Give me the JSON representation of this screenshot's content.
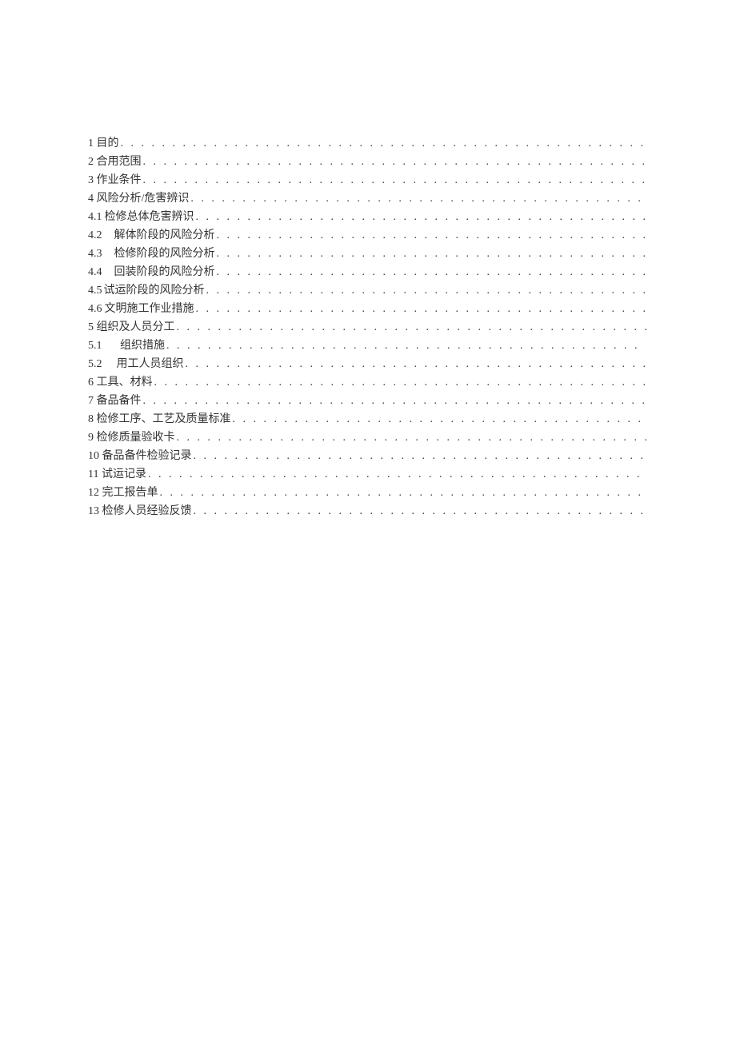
{
  "toc": [
    {
      "label": "1 目的",
      "dots": ". . . . . . . . . . . . . . . . . . . . . . . . . . . . . . . . . . . . . . . . . . . . . . . . . . . . . . . . ."
    },
    {
      "label": "2 合用范围",
      "dots": ". . . . . . . . . . . . . . . . . . . . . . . . . . . . . . . . . . . . . . . . . . . . . . . . . . . ."
    },
    {
      "label": "3 作业条件",
      "dots": ". . . . . . . . . . . . . . . . . . . . . . . . . . . . . . . . . . . . . . . . . . . . . . . . . . . . ."
    },
    {
      "label": "4 风险分析/危害辨识",
      "dots": " . . . . . . . . . . . . . . . . . . . . . . . . . . . . . . . . . . . . . . . . . . . . . . ."
    },
    {
      "num": "4.1",
      "label": "检修总体危害辨识",
      "dots": ". . . . . . . . . . . . . . . . . . . . . . . . . . . . . . . . . . . . . . . . . . . ."
    },
    {
      "num": "4.2",
      "label": "解体阶段的风险分析",
      "dots": " . . . . . . . . . . . . . . . . . . . . . . . . . . . . . . . . . . . . . . . . . ."
    },
    {
      "num": "4.3",
      "label": "检修阶段的风险分析",
      "dots": " . . . . . . . . . . . . . . . . . . . . . . . . . . . . . . . . . . . . . . . . . ."
    },
    {
      "num": "4.4",
      "label": "回装阶段的风险分析",
      "dots": " . . . . . . . . . . . . . . . . . . . . . . . . . . . . . . . . . . . . . . . . . ."
    },
    {
      "num": "4.5",
      "label": "试运阶段的风险分析",
      "dots": " . . . . . . . . . . . . . . . . . . . . . . . . . . . . . . . . . . . . . . . . . . ."
    },
    {
      "num": "4.6",
      "label": "文明施工作业措施",
      "dots": " . . . . . . . . . . . . . . . . . . . . . . . . . . . . . . . . . . . . . . . . . . . ."
    },
    {
      "label": "5 组织及人员分工",
      "dots": ". . . . . . . . . . . . . . . . . . . . . . . . . . . . . . . . . . . . . . . . . . . . . . . . ."
    },
    {
      "num": "5.1",
      "label": "组织措施",
      "dots": " . . . . . . . . . . . . . . . . . . . . . . . . . . . . . . . . . . . . . . . . . . . . . ."
    },
    {
      "num": "5.2",
      "label": "用工人员组织",
      "dots": " . . . . . . . . . . . . . . . . . . . . . . . . . . . . . . . . . . . . . . . . . . . . ."
    },
    {
      "label": "6 工具、材料",
      "dots": ". . . . . . . . . . . . . . . . . . . . . . . . . . . . . . . . . . . . . . . . . . . . . . . . ."
    },
    {
      "label": "7 备品备件",
      "dots": ". . . . . . . . . . . . . . . . . . . . . . . . . . . . . . . . . . . . . . . . . . . . . . . . . . . ."
    },
    {
      "label": "8 检修工序、工艺及质量标准",
      "dots": " . . . . . . . . . . . . . . . . . . . . . . . . . . . . . . . . . . . . . . . . . . . . ."
    },
    {
      "label": "9 检修质量验收卡",
      "dots": ". . . . . . . . . . . . . . . . . . . . . . . . . . . . . . . . . . . . . . . . . . . . . . . ."
    },
    {
      "label": "10 备品备件检验记录",
      "dots": ". . . . . . . . . . . . . . . . . . . . . . . . . . . . . . . . . . . . . . . . . . . . . . . ."
    },
    {
      "label": "11 试运记录",
      "dots": " . . . . . . . . . . . . . . . . . . . . . . . . . . . . . . . . . . . . . . . . . . . . . . . . ."
    },
    {
      "label": "12 完工报告单",
      "dots": " . . . . . . . . . . . . . . . . . . . . . . . . . . . . . . . . . . . . . . . . . . . . . . ."
    },
    {
      "label": "13 检修人员经验反馈",
      "dots": ". . . . . . . . . . . . . . . . . . . . . . . . . . . . . . . . . . . . . . . . . . . . . . ."
    }
  ]
}
